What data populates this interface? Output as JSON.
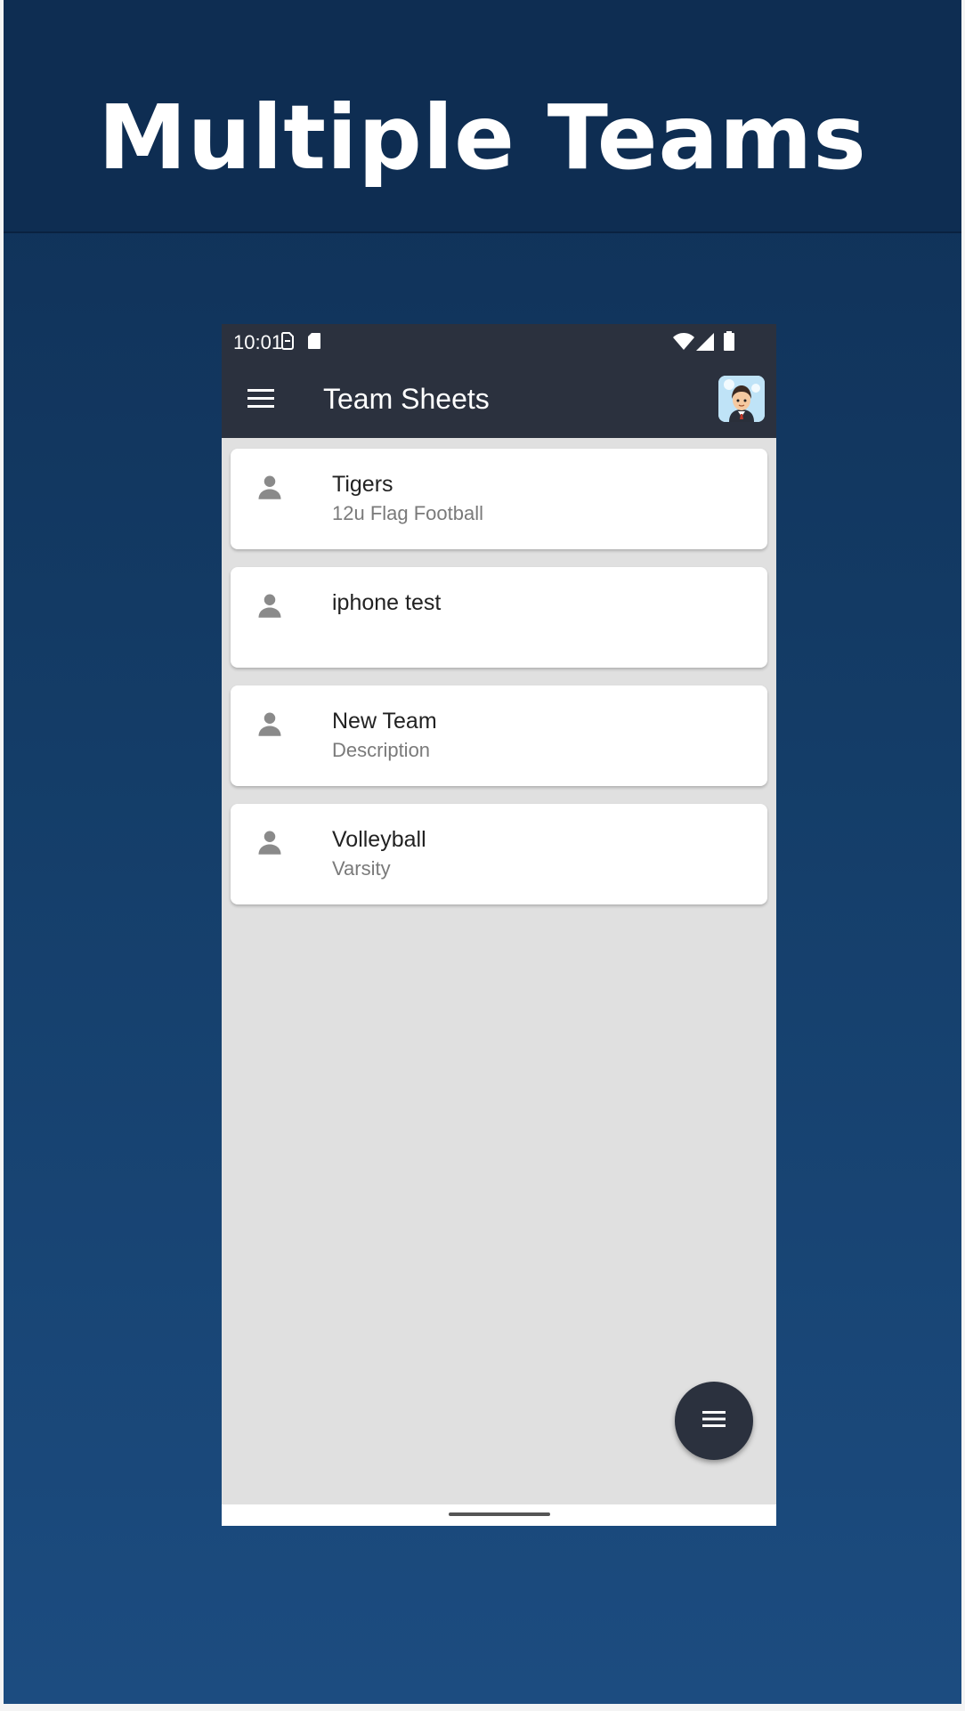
{
  "banner": {
    "headline": "Multiple Teams"
  },
  "status_bar": {
    "time": "10:01",
    "icons": [
      "sim-icon",
      "sd-card-icon",
      "wifi-icon",
      "signal-icon",
      "battery-icon"
    ]
  },
  "app_bar": {
    "title": "Team Sheets",
    "menu_icon": "menu-icon",
    "avatar": "user-avatar"
  },
  "teams": [
    {
      "name": "Tigers",
      "description": "12u Flag Football",
      "icon": "person-icon"
    },
    {
      "name": "iphone test",
      "description": "",
      "icon": "person-icon"
    },
    {
      "name": "New Team",
      "description": "Description",
      "icon": "person-icon"
    },
    {
      "name": "Volleyball",
      "description": "Varsity",
      "icon": "person-icon"
    }
  ],
  "fab": {
    "icon": "menu-icon"
  },
  "colors": {
    "app_bar": "#2b313e",
    "list_background": "#e0e0e0",
    "card": "#ffffff",
    "page_background": "#143d68"
  }
}
